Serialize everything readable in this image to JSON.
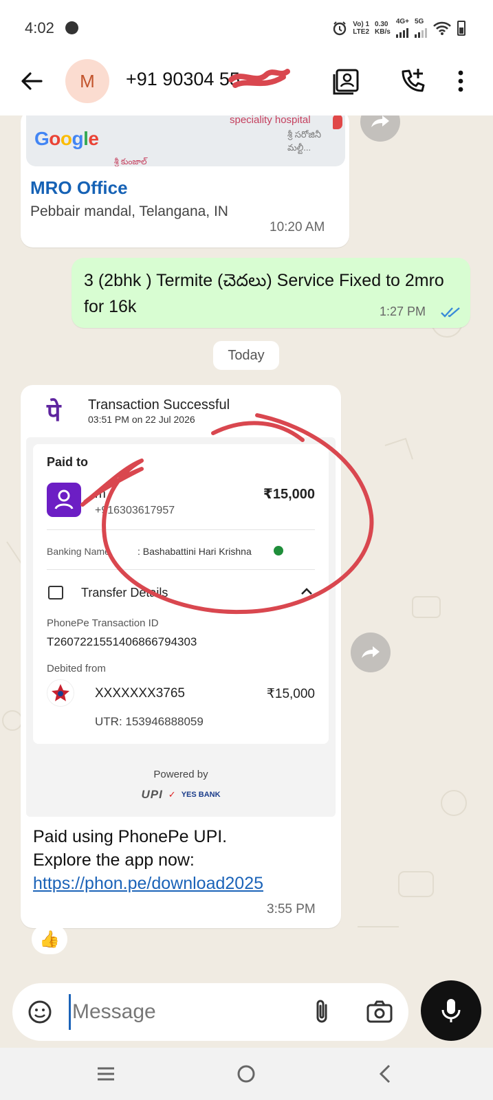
{
  "status_bar": {
    "time": "4:02",
    "net_top": "Vo) 1",
    "net_bottom": "LTE2",
    "speed_top": "0.30",
    "speed_bottom": "KB/s",
    "sim1": "4G+",
    "sim2": "5G"
  },
  "header": {
    "avatar_letter": "M",
    "contact": "+91 90304 55"
  },
  "location_message": {
    "map_label_en": "speciality hospital",
    "map_label_te": "శ్రీ సరోజినీ మల్టీ...",
    "map_label_bottom": "శ్రీ కుంజాల్",
    "map_brand": "Google",
    "title": "MRO Office",
    "address": "Pebbair mandal, Telangana, IN",
    "time": "10:20 AM"
  },
  "outgoing_message": {
    "text": "3 (2bhk ) Termite (చెదలు) Service Fixed to 2mro for 16k",
    "time": "1:27 PM"
  },
  "date_chip": "Today",
  "payment": {
    "title": "Transaction Successful",
    "subtitle": "03:51 PM on 22 Jul 2026",
    "paid_to_label": "Paid to",
    "payee_name": "m",
    "payee_phone": "+916303617957",
    "amount": "₹15,000",
    "banking_name_label": "Banking Name",
    "banking_name_value": ":  Bashabattini Hari Krishna",
    "transfer_details_label": "Transfer Details",
    "txn_id_label": "PhonePe Transaction ID",
    "txn_id": "T2607221551406866794303",
    "debited_label": "Debited from",
    "account": "XXXXXXX3765",
    "debited_amount": "₹15,000",
    "utr": "UTR: 153946888059",
    "powered_by": "Powered by",
    "upi": "UPI",
    "bank": "YES BANK",
    "msg_line1": "Paid using PhonePe UPI.",
    "msg_line2": "Explore the app now:",
    "link": "https://phon.pe/download2025",
    "time": "3:55 PM"
  },
  "reaction": "👍",
  "composer": {
    "placeholder": "Message"
  },
  "colors": {
    "phonepe_purple": "#5f259f",
    "link_blue": "#1b63b8",
    "outgoing_bubble": "#d8fdd2",
    "read_tick": "#3a8bd8",
    "annotation_red": "#d9474f"
  }
}
